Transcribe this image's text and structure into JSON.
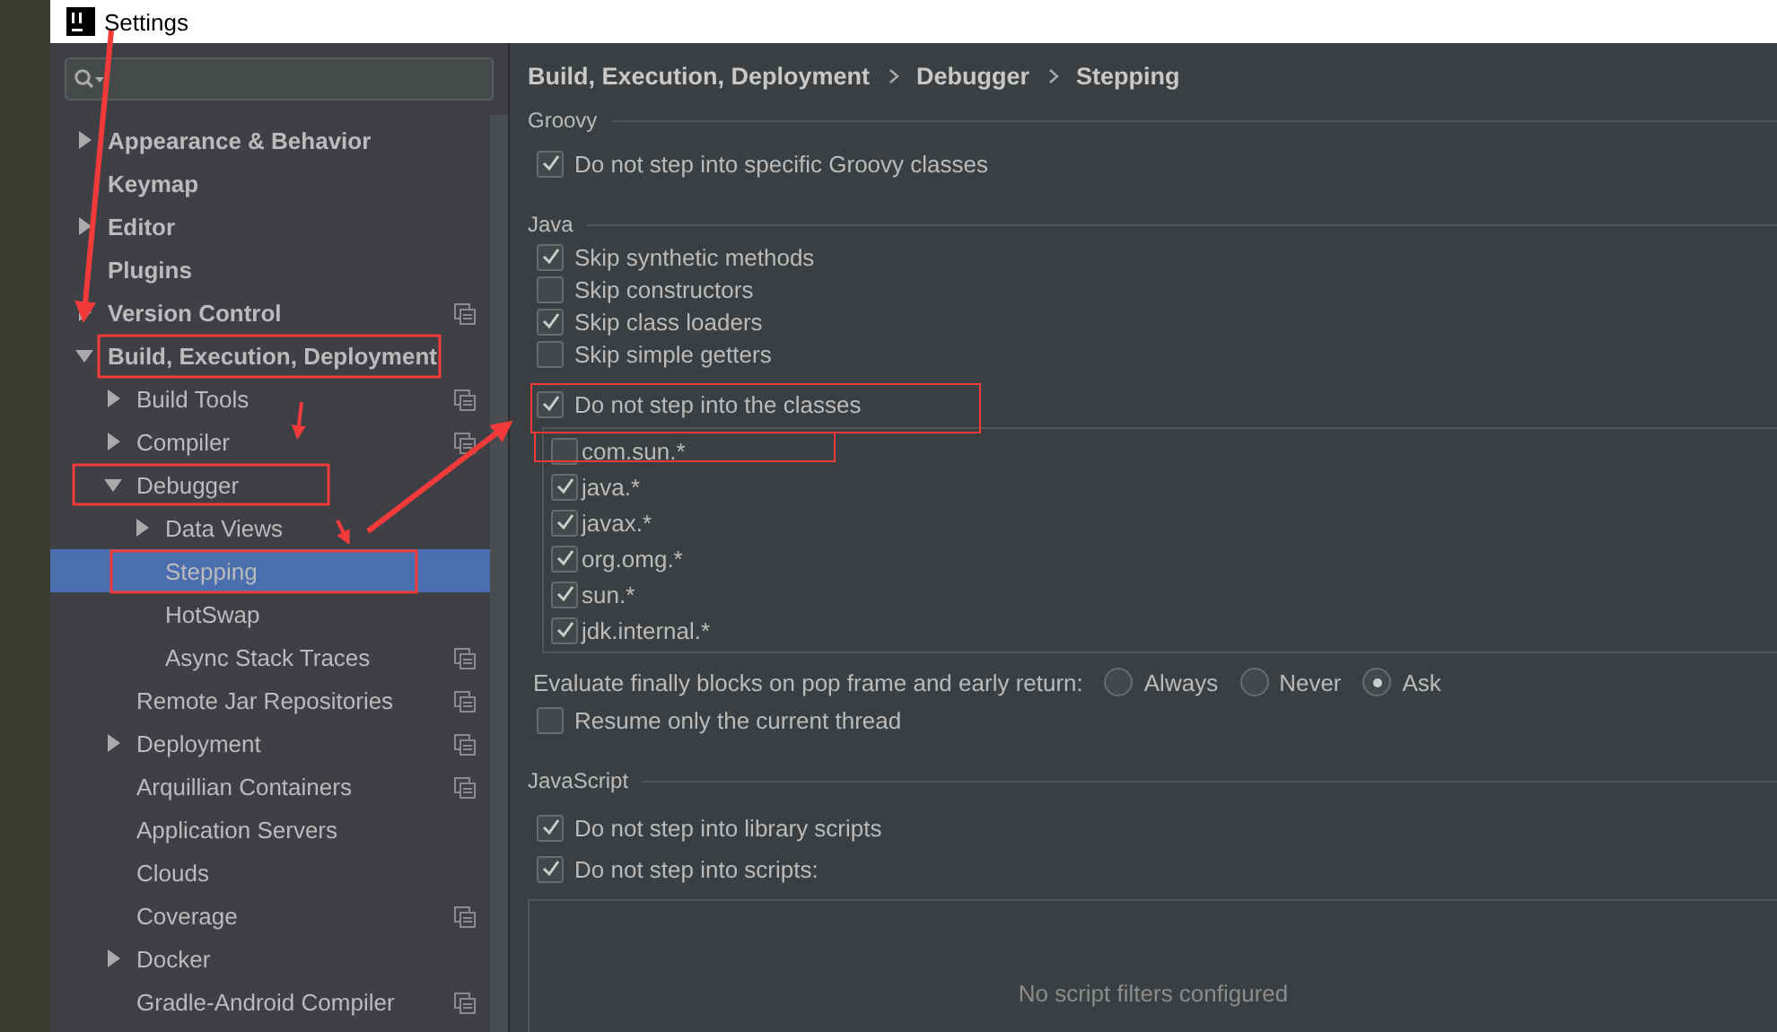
{
  "window": {
    "title": "Settings"
  },
  "sidebar": {
    "items": [
      {
        "label": "Appearance & Behavior",
        "kind": "folder",
        "expanded": false,
        "selected": false,
        "project_icon": false
      },
      {
        "label": "Keymap",
        "kind": "page",
        "selected": false,
        "project_icon": false
      },
      {
        "label": "Editor",
        "kind": "folder",
        "expanded": false,
        "selected": false,
        "project_icon": false
      },
      {
        "label": "Plugins",
        "kind": "page",
        "selected": false,
        "project_icon": false
      },
      {
        "label": "Version Control",
        "kind": "folder",
        "expanded": false,
        "selected": false,
        "project_icon": true
      },
      {
        "label": "Build, Execution, Deployment",
        "kind": "folder",
        "expanded": true,
        "selected": false,
        "project_icon": false,
        "children": [
          {
            "label": "Build Tools",
            "kind": "folder",
            "expanded": false,
            "selected": false,
            "project_icon": true
          },
          {
            "label": "Compiler",
            "kind": "folder",
            "expanded": false,
            "selected": false,
            "project_icon": true
          },
          {
            "label": "Debugger",
            "kind": "folder",
            "expanded": true,
            "selected": false,
            "project_icon": false,
            "children": [
              {
                "label": "Data Views",
                "kind": "folder",
                "expanded": false,
                "selected": false,
                "project_icon": false
              },
              {
                "label": "Stepping",
                "kind": "page",
                "selected": true,
                "project_icon": false
              },
              {
                "label": "HotSwap",
                "kind": "page",
                "selected": false,
                "project_icon": false
              },
              {
                "label": "Async Stack Traces",
                "kind": "page",
                "selected": false,
                "project_icon": true
              }
            ]
          },
          {
            "label": "Remote Jar Repositories",
            "kind": "page",
            "selected": false,
            "project_icon": true
          },
          {
            "label": "Deployment",
            "kind": "folder",
            "expanded": false,
            "selected": false,
            "project_icon": true
          },
          {
            "label": "Arquillian Containers",
            "kind": "page",
            "selected": false,
            "project_icon": true
          },
          {
            "label": "Application Servers",
            "kind": "page",
            "selected": false,
            "project_icon": false
          },
          {
            "label": "Clouds",
            "kind": "page",
            "selected": false,
            "project_icon": false
          },
          {
            "label": "Coverage",
            "kind": "page",
            "selected": false,
            "project_icon": true
          },
          {
            "label": "Docker",
            "kind": "folder",
            "expanded": false,
            "selected": false,
            "project_icon": false
          },
          {
            "label": "Gradle-Android Compiler",
            "kind": "page",
            "selected": false,
            "project_icon": true
          }
        ]
      }
    ]
  },
  "breadcrumb": [
    "Build, Execution, Deployment",
    "Debugger",
    "Stepping"
  ],
  "groovy": {
    "title": "Groovy",
    "options": [
      {
        "label": "Do not step into specific Groovy classes",
        "checked": true
      }
    ]
  },
  "java": {
    "title": "Java",
    "options": [
      {
        "label": "Skip synthetic methods",
        "checked": true
      },
      {
        "label": "Skip constructors",
        "checked": false
      },
      {
        "label": "Skip class loaders",
        "checked": true
      },
      {
        "label": "Skip simple getters",
        "checked": false
      },
      {
        "label": "Do not step into the classes",
        "checked": true
      }
    ],
    "class_filters": [
      {
        "pattern": "com.sun.*",
        "checked": false
      },
      {
        "pattern": "java.*",
        "checked": true
      },
      {
        "pattern": "javax.*",
        "checked": true
      },
      {
        "pattern": "org.omg.*",
        "checked": true
      },
      {
        "pattern": "sun.*",
        "checked": true
      },
      {
        "pattern": "jdk.internal.*",
        "checked": true
      }
    ],
    "evaluate_finally": {
      "label": "Evaluate finally blocks on pop frame and early return:",
      "options": [
        {
          "label": "Always",
          "selected": false
        },
        {
          "label": "Never",
          "selected": false
        },
        {
          "label": "Ask",
          "selected": true
        }
      ]
    },
    "resume_option": {
      "label": "Resume only the current thread",
      "checked": false
    }
  },
  "javascript": {
    "title": "JavaScript",
    "options": [
      {
        "label": "Do not step into library scripts",
        "checked": true
      },
      {
        "label": "Do not step into scripts:",
        "checked": true
      }
    ],
    "script_filters_empty": "No script filters configured"
  }
}
